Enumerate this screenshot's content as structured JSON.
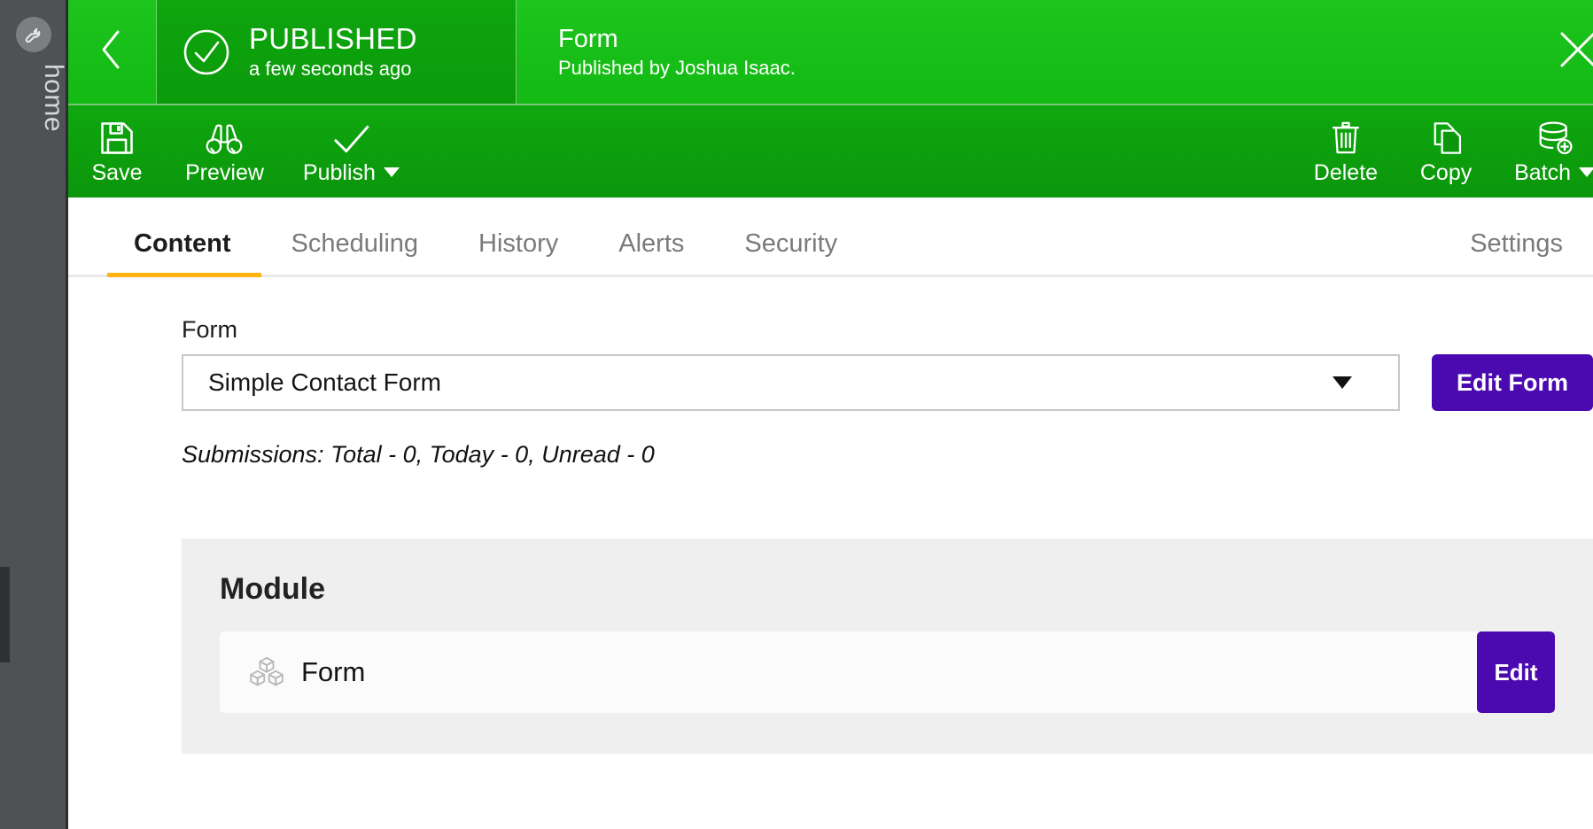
{
  "rail": {
    "gear_icon": "wrench-icon",
    "home_label": "home"
  },
  "statusbar": {
    "back_icon": "chevron-left-icon",
    "status_icon": "check-circle-icon",
    "status_title": "PUBLISHED",
    "status_time": "a few seconds ago",
    "doc_title": "Form",
    "doc_subtitle": "Published by Joshua Isaac.",
    "close_icon": "close-icon"
  },
  "toolbar": {
    "left_buttons": [
      {
        "label": "Save",
        "icon": "floppy-disk-icon",
        "caret": false
      },
      {
        "label": "Preview",
        "icon": "binoculars-icon",
        "caret": false
      },
      {
        "label": "Publish",
        "icon": "check-icon",
        "caret": true
      }
    ],
    "right_buttons": [
      {
        "label": "Delete",
        "icon": "trash-icon",
        "caret": false
      },
      {
        "label": "Copy",
        "icon": "copy-icon",
        "caret": false
      },
      {
        "label": "Batch",
        "icon": "database-add-icon",
        "caret": true
      }
    ]
  },
  "tabs": {
    "items": [
      {
        "label": "Content",
        "active": true
      },
      {
        "label": "Scheduling",
        "active": false
      },
      {
        "label": "History",
        "active": false
      },
      {
        "label": "Alerts",
        "active": false
      },
      {
        "label": "Security",
        "active": false
      }
    ],
    "settings_label": "Settings",
    "active_underline_color": "#ffb511"
  },
  "content": {
    "form_label": "Form",
    "form_select_value": "Simple Contact Form",
    "edit_form_button": "Edit Form",
    "submissions_text": "Submissions: Total - 0, Today - 0, Unread - 0"
  },
  "module": {
    "title": "Module",
    "row_icon": "cubes-icon",
    "row_name": "Form",
    "edit_button": "Edit"
  },
  "colors": {
    "published_green": "#0fa60f",
    "toolbar_green": "#0b960b",
    "accent_purple": "#4b09b0",
    "tab_underline_yellow": "#ffb511",
    "rail_gray": "#4e5254"
  }
}
